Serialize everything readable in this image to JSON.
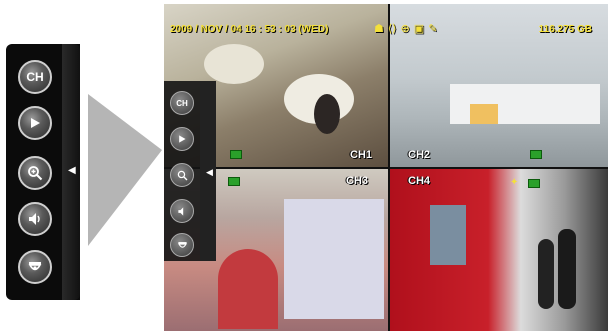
{
  "toolbar": {
    "ch_label": "CH",
    "buttons": [
      "channel",
      "play",
      "zoom",
      "audio",
      "ptz"
    ],
    "expand_arrow": "◀"
  },
  "status_bar": {
    "datetime": "2009 / NOV / 04 16 : 53 : 03 (WED)",
    "hdd_capacity": "116.275 GB"
  },
  "cameras": [
    {
      "label": "CH1"
    },
    {
      "label": "CH2"
    },
    {
      "label": "CH3"
    },
    {
      "label": "CH4"
    }
  ],
  "colors": {
    "overlay_text": "#f4e03a",
    "record_indicator": "#2aa02a",
    "toolbar_bg": "#0b0b0b"
  }
}
